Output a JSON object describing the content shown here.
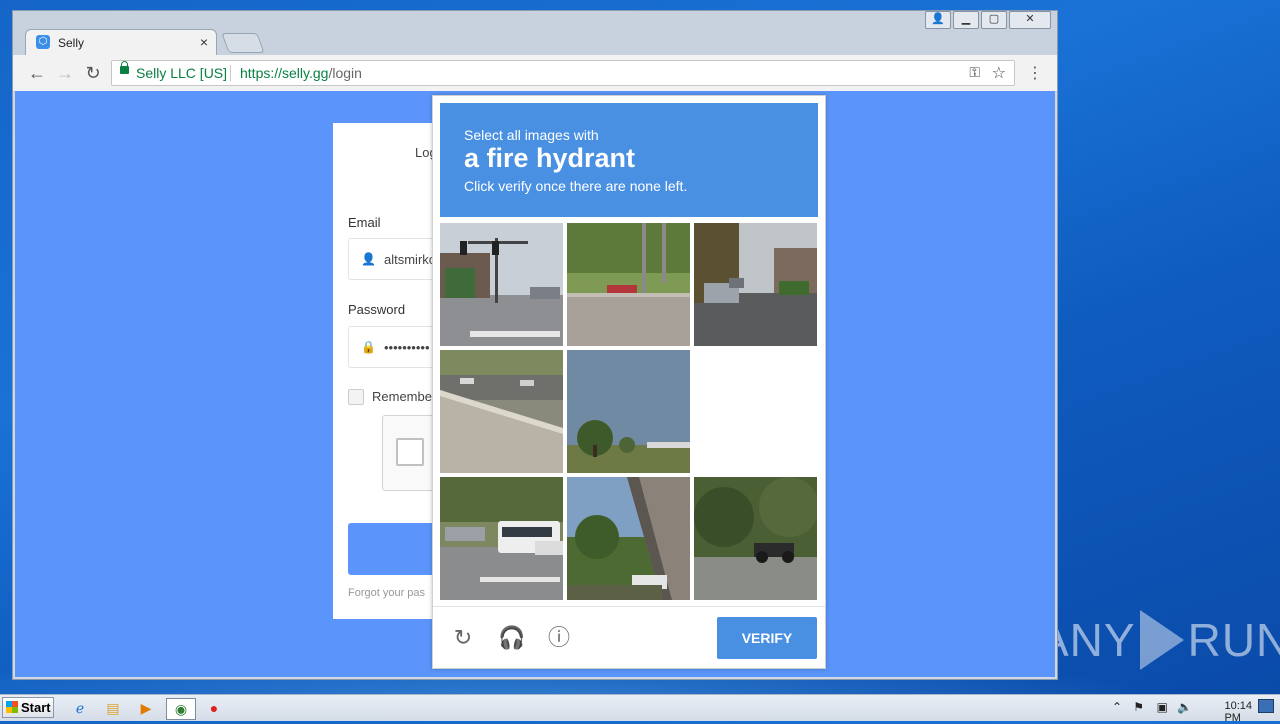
{
  "browser": {
    "tab_title": "Selly",
    "tab_close": "×",
    "secure_label": "Selly LLC [US]",
    "url_host": "https://selly.gg",
    "url_path": "/login",
    "nav": {
      "back": "←",
      "forward": "→",
      "reload": "↻"
    },
    "key_icon": "⚿",
    "star_icon": "☆",
    "menu_icon": "⋮",
    "win_buttons": {
      "user": "👤",
      "minimize": "▁",
      "maximize": "▢",
      "close": "✕"
    }
  },
  "login": {
    "tab_label": "Log",
    "email_label": "Email",
    "email_value": "altsmirkc",
    "password_label": "Password",
    "password_value": "••••••••••",
    "remember_label": "Remember",
    "forgot_text": "Forgot your pas"
  },
  "captcha": {
    "instruction_line1": "Select all images with",
    "target": "a fire hydrant",
    "instruction_line3": "Click verify once there are none left.",
    "verify_label": "VERIFY",
    "icons": {
      "reload": "↻",
      "audio": "🎧",
      "info": "ⓘ"
    },
    "tiles": [
      "street-intersection-traffic-light",
      "concrete-wall-grass-hill",
      "street-parked-cars-trees",
      "highway-concrete-barrier",
      "tree-open-field-sky",
      "blank-loading",
      "road-white-bus-parking",
      "underpass-trees",
      "trees-road-motorcycle"
    ]
  },
  "taskbar": {
    "start_label": "Start",
    "clock": "10:14 PM"
  },
  "watermark": {
    "left": "ANY",
    "right": "RUN"
  }
}
